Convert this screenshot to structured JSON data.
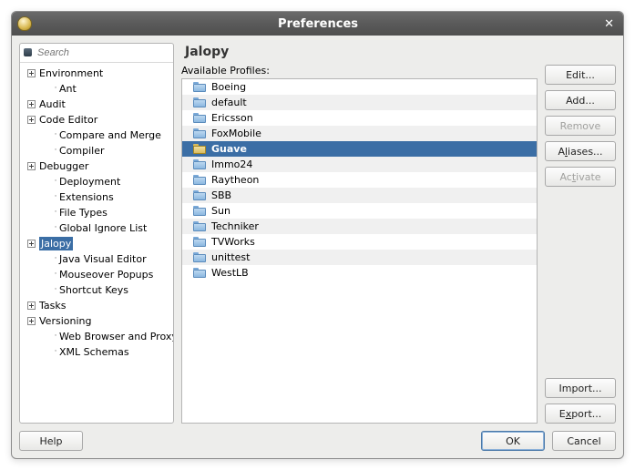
{
  "window": {
    "title": "Preferences"
  },
  "search": {
    "placeholder": "Search"
  },
  "tree": {
    "items": [
      {
        "label": "Environment",
        "expandable": true,
        "level": 0
      },
      {
        "label": "Ant",
        "expandable": false,
        "level": 1
      },
      {
        "label": "Audit",
        "expandable": true,
        "level": 0
      },
      {
        "label": "Code Editor",
        "expandable": true,
        "level": 0
      },
      {
        "label": "Compare and Merge",
        "expandable": false,
        "level": 1
      },
      {
        "label": "Compiler",
        "expandable": false,
        "level": 1
      },
      {
        "label": "Debugger",
        "expandable": true,
        "level": 0
      },
      {
        "label": "Deployment",
        "expandable": false,
        "level": 1
      },
      {
        "label": "Extensions",
        "expandable": false,
        "level": 1
      },
      {
        "label": "File Types",
        "expandable": false,
        "level": 1
      },
      {
        "label": "Global Ignore List",
        "expandable": false,
        "level": 1
      },
      {
        "label": "Jalopy",
        "expandable": true,
        "level": 0,
        "selected": true
      },
      {
        "label": "Java Visual Editor",
        "expandable": false,
        "level": 1
      },
      {
        "label": "Mouseover Popups",
        "expandable": false,
        "level": 1
      },
      {
        "label": "Shortcut Keys",
        "expandable": false,
        "level": 1
      },
      {
        "label": "Tasks",
        "expandable": true,
        "level": 0
      },
      {
        "label": "Versioning",
        "expandable": true,
        "level": 0
      },
      {
        "label": "Web Browser and Proxy",
        "expandable": false,
        "level": 1
      },
      {
        "label": "XML Schemas",
        "expandable": false,
        "level": 1
      }
    ]
  },
  "panel": {
    "title": "Jalopy",
    "profilesLabel": "Available Profiles:",
    "profiles": [
      {
        "name": "Boeing"
      },
      {
        "name": "default"
      },
      {
        "name": "Ericsson"
      },
      {
        "name": "FoxMobile"
      },
      {
        "name": "Guave",
        "selected": true
      },
      {
        "name": "Immo24"
      },
      {
        "name": "Raytheon"
      },
      {
        "name": "SBB"
      },
      {
        "name": "Sun"
      },
      {
        "name": "Techniker"
      },
      {
        "name": "TVWorks"
      },
      {
        "name": "unittest"
      },
      {
        "name": "WestLB"
      }
    ]
  },
  "buttons": {
    "edit": "Edit...",
    "add": "Add...",
    "remove": "Remove",
    "aliases": "Aliases...",
    "activate": "Activate",
    "import": "Import...",
    "export": "Export..."
  },
  "footer": {
    "help": "Help",
    "ok": "OK",
    "cancel": "Cancel"
  }
}
